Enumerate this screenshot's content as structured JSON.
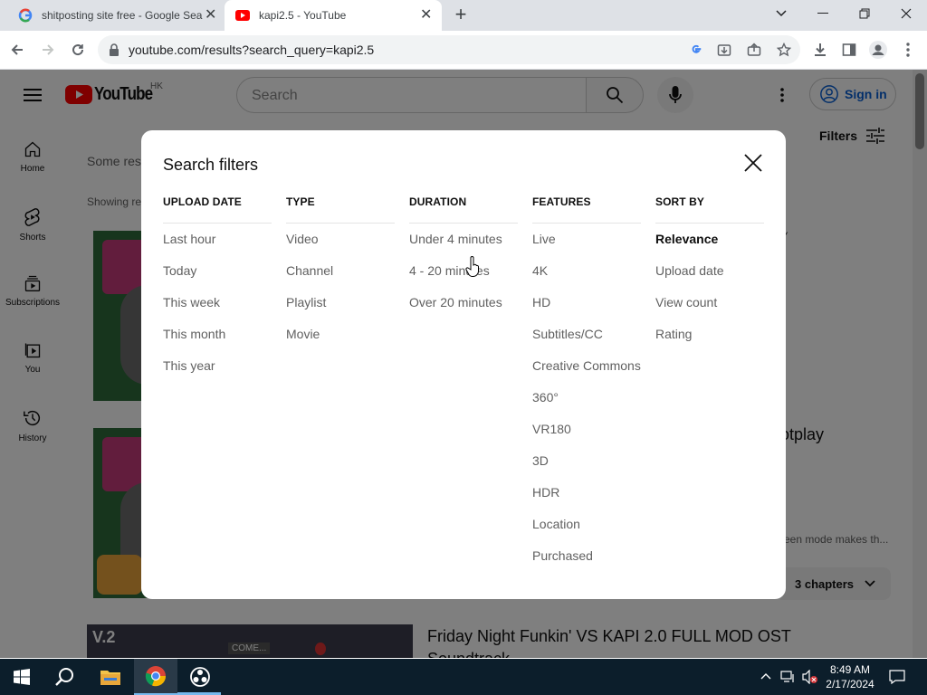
{
  "browser": {
    "tabs": [
      {
        "title": "shitposting site free - Google Sea",
        "favicon": "google-icon"
      },
      {
        "title": "kapi2.5 - YouTube",
        "favicon": "youtube-icon"
      }
    ],
    "url": "youtube.com/results?search_query=kapi2.5"
  },
  "youtube": {
    "logo_text": "YouTube",
    "region": "HK",
    "search_placeholder": "Search",
    "sign_in": "Sign in",
    "filters": "Filters",
    "sidebar": [
      {
        "label": "Home",
        "icon": "home-icon"
      },
      {
        "label": "Shorts",
        "icon": "shorts-icon"
      },
      {
        "label": "Subscriptions",
        "icon": "subscriptions-icon"
      },
      {
        "label": "You",
        "icon": "you-icon"
      },
      {
        "label": "History",
        "icon": "history-icon"
      }
    ],
    "background": {
      "notice": "Some res",
      "showing": "Showing re",
      "result2_title_fragment": "otplay",
      "result2_desc_fragment": "reen mode makes th...",
      "chapters": "3 chapters",
      "result3_title": "Friday Night Funkin' VS KAPI 2.0 FULL MOD OST",
      "result3_title_line2": "Soundtrack",
      "thumb3_label": "V.2",
      "thumb3_sign": "COME..."
    }
  },
  "filters_modal": {
    "title": "Search filters",
    "columns": [
      {
        "heading": "UPLOAD DATE",
        "options": [
          "Last hour",
          "Today",
          "This week",
          "This month",
          "This year"
        ]
      },
      {
        "heading": "TYPE",
        "options": [
          "Video",
          "Channel",
          "Playlist",
          "Movie"
        ]
      },
      {
        "heading": "DURATION",
        "options": [
          "Under 4 minutes",
          "4 - 20 minutes",
          "Over 20 minutes"
        ]
      },
      {
        "heading": "FEATURES",
        "options": [
          "Live",
          "4K",
          "HD",
          "Subtitles/CC",
          "Creative Commons",
          "360°",
          "VR180",
          "3D",
          "HDR",
          "Location",
          "Purchased"
        ]
      },
      {
        "heading": "SORT BY",
        "options": [
          "Relevance",
          "Upload date",
          "View count",
          "Rating"
        ],
        "selected": "Relevance"
      }
    ]
  },
  "taskbar": {
    "time": "8:49 AM",
    "date": "2/17/2024"
  },
  "colors": {
    "youtube_red": "#ff0000",
    "link_blue": "#065fd4",
    "taskbar": "#0c1e2b"
  }
}
